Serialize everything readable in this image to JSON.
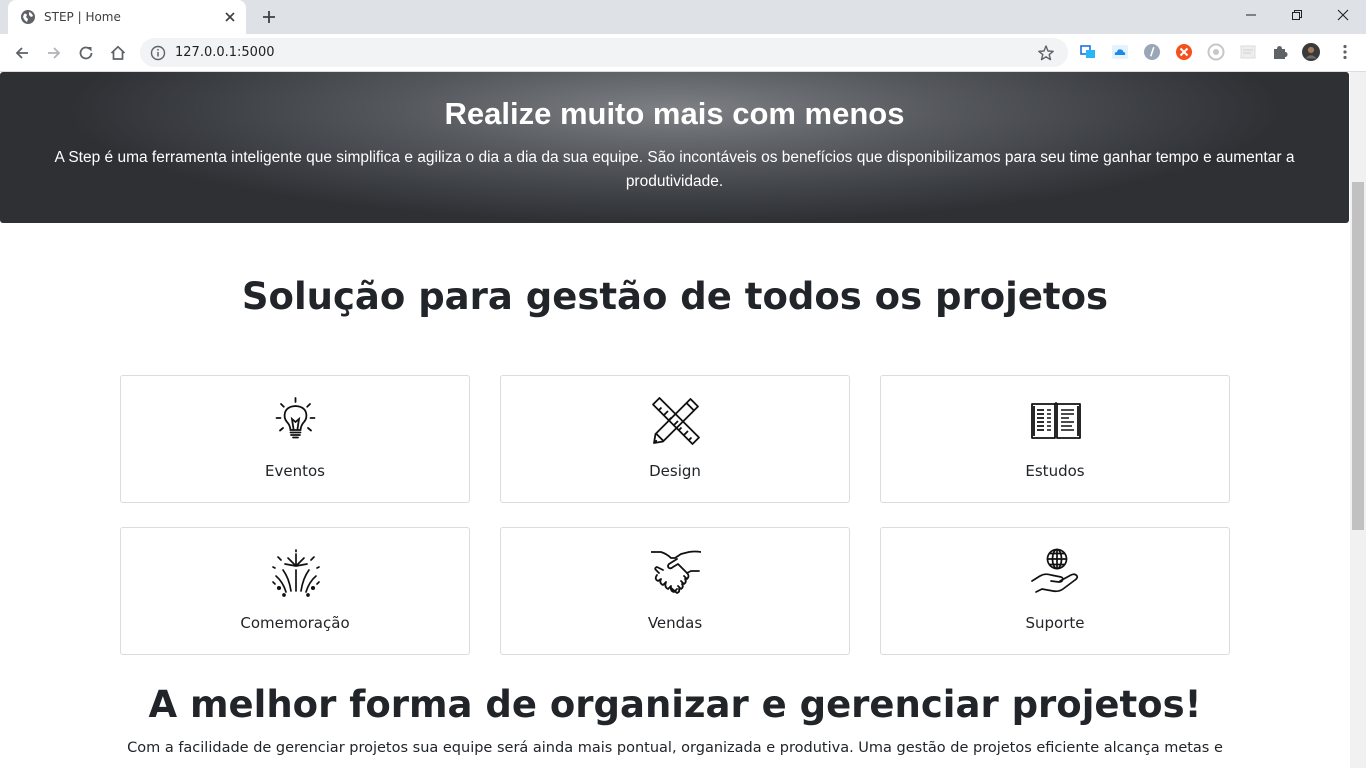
{
  "browser": {
    "tab_title": "STEP | Home",
    "url": "127.0.0.1:5000",
    "extensions": [
      "screen-capture-icon",
      "cloud-icon",
      "script-icon",
      "orange-extension-icon",
      "refresh-circle-icon",
      "blank-extension-icon",
      "puzzle-icon",
      "profile-avatar"
    ]
  },
  "hero": {
    "title": "Realize muito mais com menos",
    "text": "A Step é uma ferramenta inteligente que simplifica e agiliza o dia a dia da sua equipe. São incontáveis os benefícios que disponibilizamos para seu time ganhar tempo e aumentar a produtividade."
  },
  "solutions": {
    "title": "Solução para gestão de todos os projetos",
    "cards": [
      {
        "label": "Eventos",
        "icon": "lightbulb-icon"
      },
      {
        "label": "Design",
        "icon": "pencil-ruler-icon"
      },
      {
        "label": "Estudos",
        "icon": "open-book-icon"
      },
      {
        "label": "Comemoração",
        "icon": "fireworks-icon"
      },
      {
        "label": "Vendas",
        "icon": "handshake-icon"
      },
      {
        "label": "Suporte",
        "icon": "globe-hand-icon"
      }
    ]
  },
  "organize": {
    "title": "A melhor forma de organizar e gerenciar projetos!",
    "text": "Com a facilidade de gerenciar projetos sua equipe será ainda mais pontual, organizada e produtiva. Uma gestão de projetos eficiente alcança metas e"
  },
  "colors": {
    "hero_dark": "#3b3e43",
    "hero_light": "#7d8085",
    "card_border": "#dcdcdc",
    "text": "#212529"
  }
}
